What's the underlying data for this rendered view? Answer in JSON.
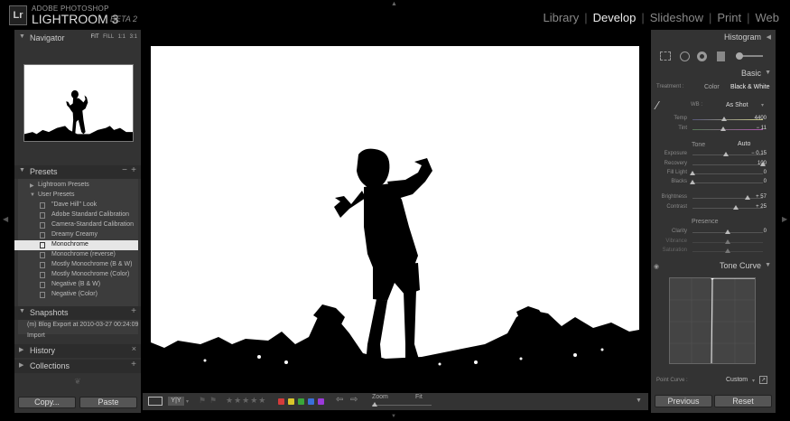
{
  "app": {
    "vendor": "ADOBE PHOTOSHOP",
    "name": "LIGHTROOM 3",
    "edition": "BETA 2",
    "logo_text": "Lr"
  },
  "modules": [
    "Library",
    "Develop",
    "Slideshow",
    "Print",
    "Web"
  ],
  "active_module": "Develop",
  "navigator": {
    "title": "Navigator",
    "zoom_options": [
      "FIT",
      "FILL",
      "1:1",
      "3:1"
    ]
  },
  "presets": {
    "title": "Presets",
    "groups": [
      {
        "label": "Lightroom Presets",
        "collapsed": true
      },
      {
        "label": "User Presets",
        "collapsed": false
      }
    ],
    "items": [
      "\"Dave Hill\" Look",
      "Adobe Standard Calibration",
      "Camera-Standard Calibration",
      "Dreamy Creamy",
      "Monochrome",
      "Monochrome (reverse)",
      "Mostly Monochrome (B & W)",
      "Mostly Monochrome (Color)",
      "Negative (B & W)",
      "Negative (Color)"
    ],
    "selected": "Monochrome"
  },
  "snapshots": {
    "title": "Snapshots",
    "items": [
      "(m) Blog Export at 2010-03-27 00:24:09",
      "Import"
    ]
  },
  "history": {
    "title": "History"
  },
  "collections": {
    "title": "Collections"
  },
  "left_buttons": {
    "copy": "Copy...",
    "paste": "Paste"
  },
  "toolbar": {
    "zoom_label": "Zoom",
    "fit_label": "Fit",
    "color_labels": [
      "#d33b3b",
      "#d9c52b",
      "#3aa63a",
      "#3a6fd9",
      "#9b3ad9"
    ]
  },
  "histogram": {
    "title": "Histogram"
  },
  "basic": {
    "title": "Basic",
    "treatment_label": "Treatment :",
    "treatment_options": [
      "Color",
      "Black & White"
    ],
    "treatment_selected": "Black & White",
    "wb_label": "WB :",
    "wb_value": "As Shot",
    "temp": {
      "label": "Temp",
      "value": "4400",
      "level": 0.45
    },
    "tint": {
      "label": "Tint",
      "value": "− 11",
      "level": 0.44
    },
    "tone_label": "Tone",
    "auto_label": "Auto",
    "exposure": {
      "label": "Exposure",
      "value": "− 0.15",
      "level": 0.48
    },
    "recovery": {
      "label": "Recovery",
      "value": "100",
      "level": 1.0
    },
    "fill_light": {
      "label": "Fill Light",
      "value": "0",
      "level": 0.0
    },
    "blacks": {
      "label": "Blacks",
      "value": "0",
      "level": 0.0
    },
    "brightness": {
      "label": "Brightness",
      "value": "+ 57",
      "level": 0.78
    },
    "contrast": {
      "label": "Contrast",
      "value": "+ 25",
      "level": 0.62
    },
    "presence_label": "Presence",
    "clarity": {
      "label": "Clarity",
      "value": "0",
      "level": 0.5
    },
    "vibrance": {
      "label": "Vibrance",
      "value": "",
      "level": 0.5
    },
    "saturation": {
      "label": "Saturation",
      "value": "",
      "level": 0.5
    }
  },
  "tone_curve": {
    "title": "Tone Curve",
    "point_curve_label": "Point Curve :",
    "point_curve_value": "Custom"
  },
  "right_buttons": {
    "previous": "Previous",
    "reset": "Reset"
  },
  "colors": {
    "panel": "#333333",
    "background": "#000000",
    "selected_row": "#e6e6e6"
  }
}
